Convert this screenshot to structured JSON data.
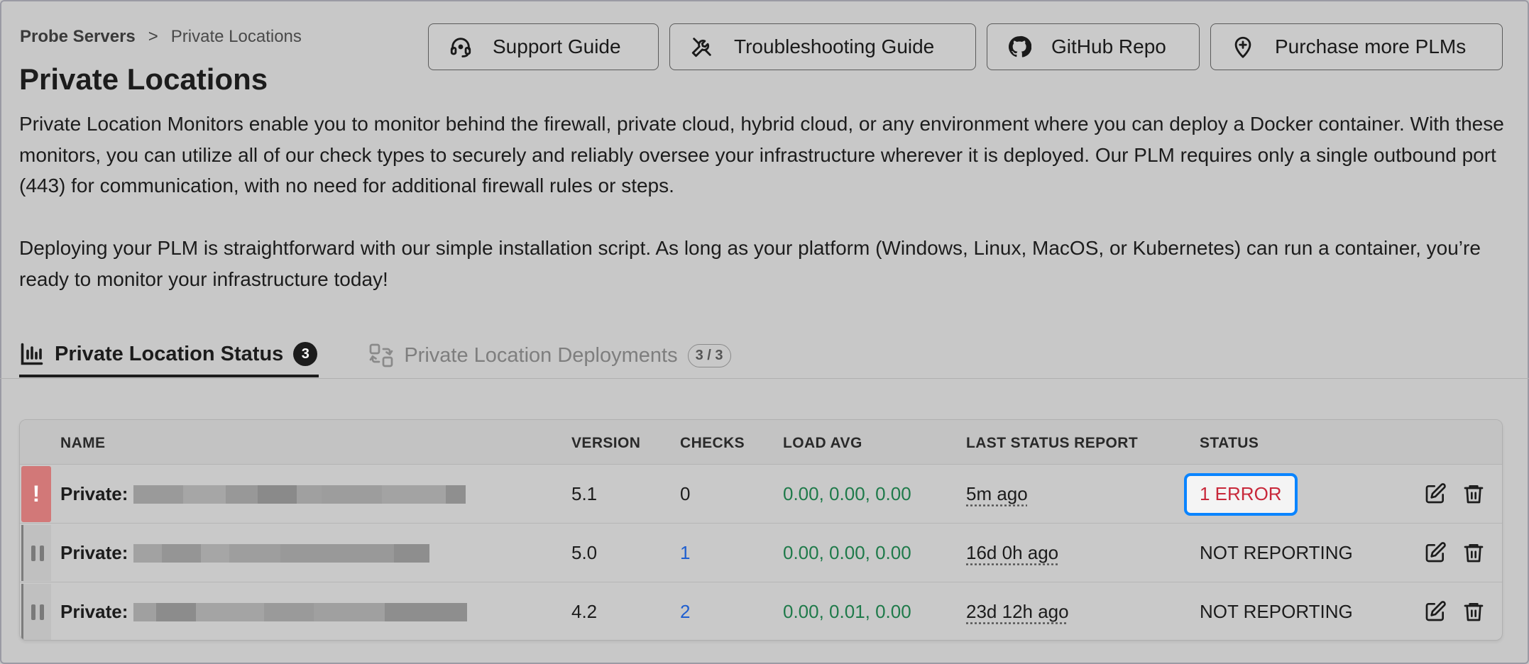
{
  "breadcrumb": {
    "root": "Probe Servers",
    "separator": ">",
    "current": "Private Locations"
  },
  "page_title": "Private Locations",
  "header_buttons": [
    {
      "label": "Support Guide",
      "icon": "headset-icon"
    },
    {
      "label": "Troubleshooting Guide",
      "icon": "tools-icon"
    },
    {
      "label": "GitHub Repo",
      "icon": "github-icon"
    },
    {
      "label": "Purchase more PLMs",
      "icon": "location-plus-icon"
    }
  ],
  "description": {
    "p1": "Private Location Monitors enable you to monitor behind the firewall, private cloud, hybrid cloud, or any environment where you can deploy a Docker container. With these monitors, you can utilize all of our check types to securely and reliably oversee your infrastructure wherever it is deployed. Our PLM requires only a single outbound port (443) for communication, with no need for additional firewall rules or steps.",
    "p2": "Deploying your PLM is straightforward with our simple installation script. As long as your platform (Windows, Linux, MacOS, or Kubernetes) can run a container, you’re ready to monitor your infrastructure today!"
  },
  "tabs": [
    {
      "label": "Private Location Status",
      "badge": "3",
      "active": true,
      "icon": "bar-chart-icon"
    },
    {
      "label": "Private Location Deployments",
      "badge": "3 / 3",
      "active": false,
      "icon": "deployments-icon"
    }
  ],
  "table": {
    "columns": [
      "NAME",
      "VERSION",
      "CHECKS",
      "LOAD AVG",
      "LAST STATUS REPORT",
      "STATUS"
    ],
    "rows": [
      {
        "indicator": "!",
        "name_prefix": "Private:",
        "version": "5.1",
        "checks": "0",
        "load_avg": "0.00, 0.00, 0.00",
        "last_report": "5m ago",
        "status": "1 ERROR"
      },
      {
        "indicator": "paused",
        "name_prefix": "Private:",
        "version": "5.0",
        "checks": "1",
        "load_avg": "0.00, 0.00, 0.00",
        "last_report": "16d 0h ago",
        "status": "NOT REPORTING"
      },
      {
        "indicator": "paused",
        "name_prefix": "Private:",
        "version": "4.2",
        "checks": "2",
        "load_avg": "0.00, 0.01, 0.00",
        "last_report": "23d 12h ago",
        "status": "NOT REPORTING"
      }
    ]
  },
  "colors": {
    "error_red": "#c8283a",
    "load_green": "#1f7a4a",
    "link_blue": "#1f5fd0",
    "focus_blue": "#0a84ff"
  }
}
